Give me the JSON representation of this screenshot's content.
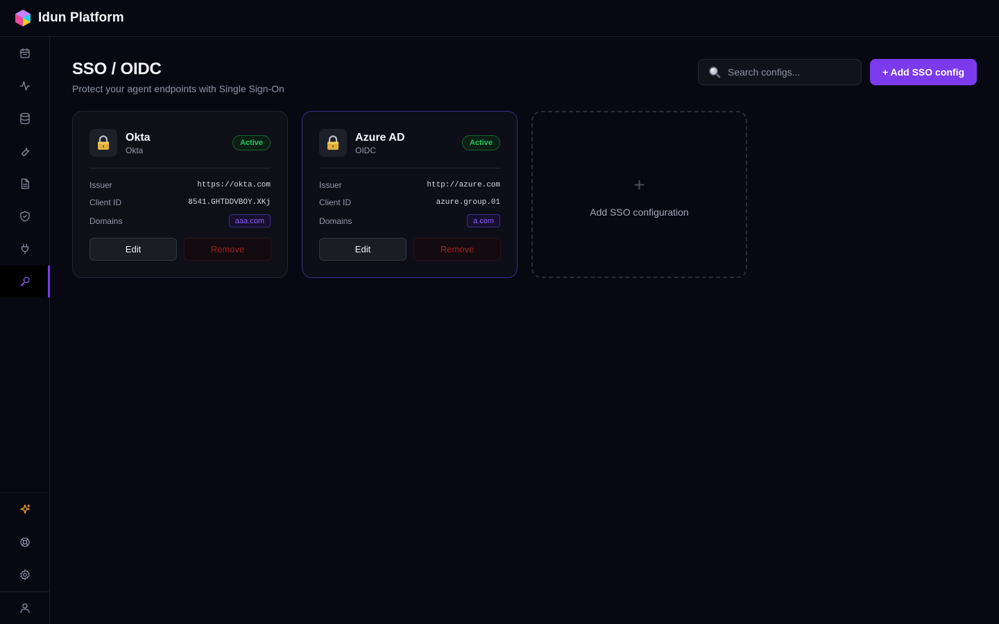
{
  "app": {
    "brand": "Idun Platform"
  },
  "header": {
    "title": "SSO / OIDC",
    "subtitle": "Protect your agent endpoints with Single Sign-On",
    "search_placeholder": "Search configs...",
    "add_button": "+ Add SSO config"
  },
  "sidebar": {
    "items": [
      {
        "icon": "calendar-icon"
      },
      {
        "icon": "activity-icon"
      },
      {
        "icon": "database-icon"
      },
      {
        "icon": "wrench-icon"
      },
      {
        "icon": "document-icon"
      },
      {
        "icon": "shield-icon"
      },
      {
        "icon": "plug-icon"
      },
      {
        "icon": "key-icon",
        "active": true
      }
    ],
    "bottom_items": [
      {
        "icon": "sparkle-icon"
      },
      {
        "icon": "lifebuoy-icon"
      },
      {
        "icon": "gear-icon"
      },
      {
        "icon": "user-icon"
      }
    ]
  },
  "labels": {
    "issuer": "Issuer",
    "client_id": "Client ID",
    "domains": "Domains",
    "edit": "Edit",
    "remove": "Remove"
  },
  "configs": [
    {
      "name": "Okta",
      "type": "Okta",
      "status": "Active",
      "issuer": "https://okta.com",
      "client_id": "8541.GHTDDVBOY.XKj",
      "domain": "aaa.com"
    },
    {
      "name": "Azure AD",
      "type": "OIDC",
      "status": "Active",
      "issuer": "http://azure.com",
      "client_id": "azure.group.01",
      "domain": "a.com"
    }
  ],
  "add_card": {
    "plus": "+",
    "label": "Add SSO configuration"
  },
  "colors": {
    "accent": "#7c3aed",
    "status_active": "#22c55e",
    "danger": "#9b2222",
    "background": "#070812"
  }
}
